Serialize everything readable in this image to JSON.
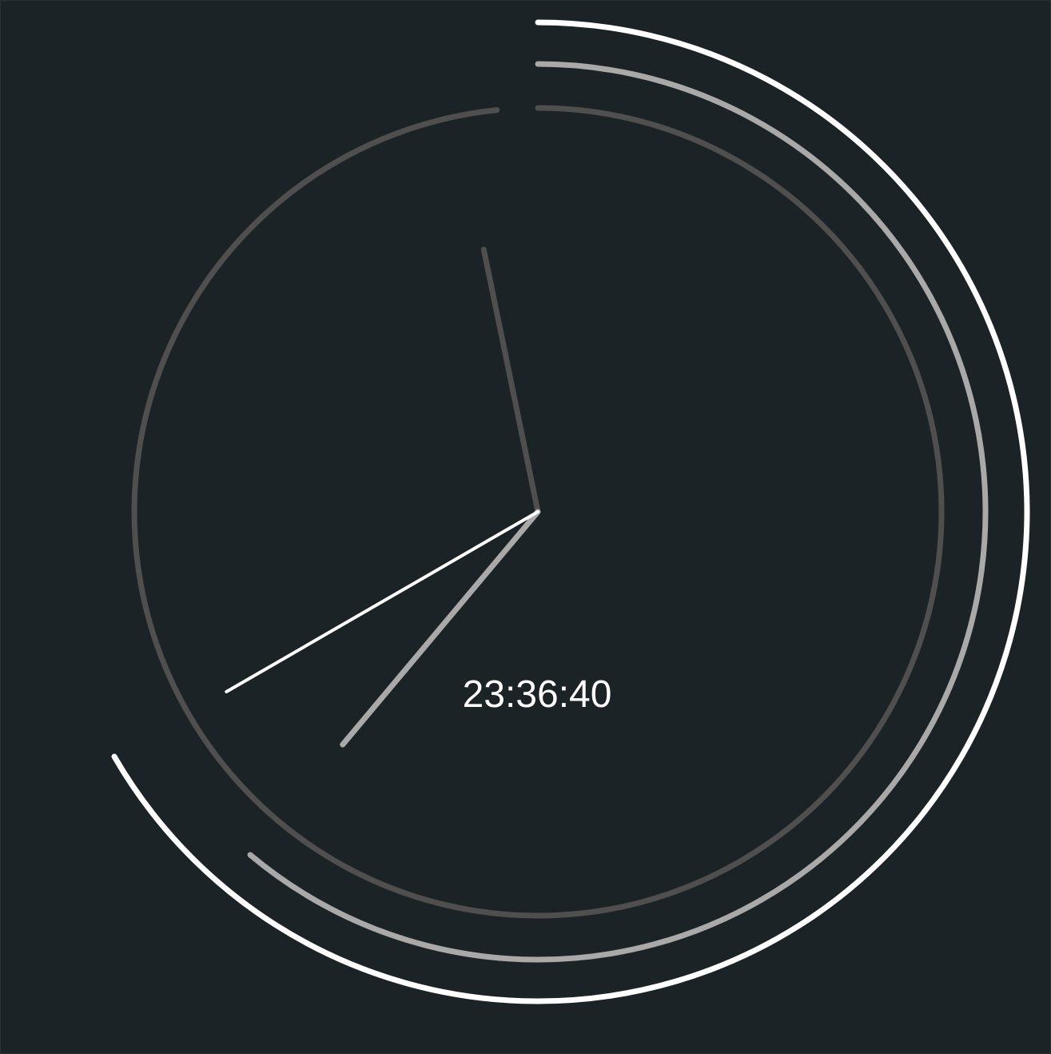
{
  "clock": {
    "time_text": "23:36:40",
    "hours": 23,
    "minutes": 36,
    "seconds": 40,
    "colors": {
      "background": "#1c2326",
      "hour": "#4f4f4f",
      "minute": "#a9a9a9",
      "second": "#ffffff"
    }
  }
}
